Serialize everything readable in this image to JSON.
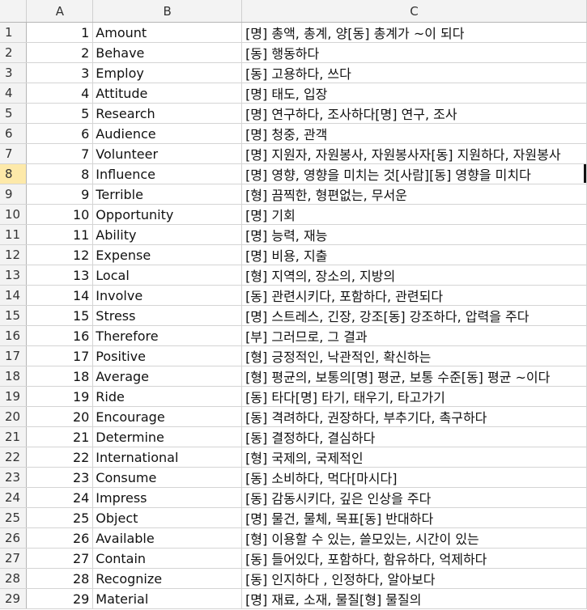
{
  "columns": [
    "A",
    "B",
    "C"
  ],
  "selected_row": "8",
  "rows": [
    {
      "n": "1",
      "a": "1",
      "b": "Amount",
      "c": "[명] 총액, 총계, 양[동] 총계가 ~이 되다"
    },
    {
      "n": "2",
      "a": "2",
      "b": "Behave",
      "c": "[동] 행동하다"
    },
    {
      "n": "3",
      "a": "3",
      "b": "Employ",
      "c": "[동] 고용하다, 쓰다"
    },
    {
      "n": "4",
      "a": "4",
      "b": "Attitude",
      "c": "[명] 태도, 입장"
    },
    {
      "n": "5",
      "a": "5",
      "b": "Research",
      "c": "[명] 연구하다, 조사하다[명] 연구, 조사"
    },
    {
      "n": "6",
      "a": "6",
      "b": "Audience",
      "c": "[명] 청중, 관객"
    },
    {
      "n": "7",
      "a": "7",
      "b": "Volunteer",
      "c": "[명] 지원자, 자원봉사, 자원봉사자[동] 지원하다, 자원봉사"
    },
    {
      "n": "8",
      "a": "8",
      "b": "Influence",
      "c": "[명] 영향, 영향을 미치는 것[사람][동] 영향을 미치다"
    },
    {
      "n": "9",
      "a": "9",
      "b": "Terrible",
      "c": "[형] 끔찍한, 형편없는, 무서운"
    },
    {
      "n": "10",
      "a": "10",
      "b": "Opportunity",
      "c": "[명] 기회"
    },
    {
      "n": "11",
      "a": "11",
      "b": "Ability",
      "c": "[명] 능력, 재능"
    },
    {
      "n": "12",
      "a": "12",
      "b": "Expense",
      "c": "[명] 비용, 지출"
    },
    {
      "n": "13",
      "a": "13",
      "b": "Local",
      "c": "[형] 지역의, 장소의, 지방의"
    },
    {
      "n": "14",
      "a": "14",
      "b": "Involve",
      "c": "[동] 관련시키다, 포함하다, 관련되다"
    },
    {
      "n": "15",
      "a": "15",
      "b": "Stress",
      "c": "[명] 스트레스, 긴장, 강조[동] 강조하다, 압력을 주다"
    },
    {
      "n": "16",
      "a": "16",
      "b": "Therefore",
      "c": "[부] 그러므로, 그 결과"
    },
    {
      "n": "17",
      "a": "17",
      "b": "Positive",
      "c": "[형] 긍정적인, 낙관적인, 확신하는"
    },
    {
      "n": "18",
      "a": "18",
      "b": "Average",
      "c": "[형] 평균의, 보통의[명] 평균, 보통 수준[동] 평균 ~이다"
    },
    {
      "n": "19",
      "a": "19",
      "b": "Ride",
      "c": "[동] 타다[명] 타기, 태우기, 타고가기"
    },
    {
      "n": "20",
      "a": "20",
      "b": "Encourage",
      "c": "[동] 격려하다, 권장하다, 부추기다, 촉구하다"
    },
    {
      "n": "21",
      "a": "21",
      "b": "Determine",
      "c": "[동] 결정하다, 결심하다"
    },
    {
      "n": "22",
      "a": "22",
      "b": "International",
      "c": "[형] 국제의, 국제적인"
    },
    {
      "n": "23",
      "a": "23",
      "b": "Consume",
      "c": "[동] 소비하다, 먹다[마시다]"
    },
    {
      "n": "24",
      "a": "24",
      "b": "Impress",
      "c": "[동] 감동시키다, 깊은 인상을 주다"
    },
    {
      "n": "25",
      "a": "25",
      "b": "Object",
      "c": "[명] 물건, 물체, 목표[동] 반대하다"
    },
    {
      "n": "26",
      "a": "26",
      "b": "Available",
      "c": "[형] 이용할 수 있는, 쓸모있는, 시간이 있는"
    },
    {
      "n": "27",
      "a": "27",
      "b": "Contain",
      "c": "[동] 들어있다, 포함하다, 함유하다, 억제하다"
    },
    {
      "n": "28",
      "a": "28",
      "b": "Recognize",
      "c": "[동] 인지하다 , 인정하다, 알아보다"
    },
    {
      "n": "29",
      "a": "29",
      "b": "Material",
      "c": "[명] 재료, 소재, 물질[형] 물질의"
    }
  ]
}
